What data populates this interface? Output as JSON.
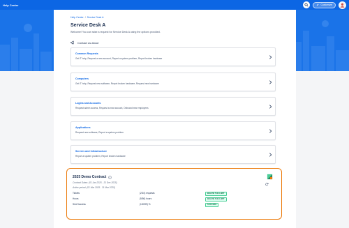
{
  "topbar": {
    "brand": "Help Center",
    "search_icon": "search-icon",
    "customize_label": "Customize",
    "customize_icon": "pencil-icon",
    "avatar_icon": "user-avatar-icon"
  },
  "breadcrumb": {
    "items": [
      "Help Center",
      "Service Desk A"
    ],
    "separator": "/"
  },
  "header": {
    "title": "Service Desk A",
    "subtitle": "Welcome! You can raise a request for Service Desk A using the options provided."
  },
  "contact": {
    "label": "Contact us about",
    "icon": "megaphone-icon"
  },
  "request_groups": [
    {
      "title": "Common Requests",
      "description": "Get IT help, Request a new account, Report a system problem, Report broken hardware"
    },
    {
      "title": "Computers",
      "description": "Get IT help, Request new software, Report broken hardware, Request new hardware"
    },
    {
      "title": "Logins and Accounts",
      "description": "Request admin access, Request a new account, Onboard new employees"
    },
    {
      "title": "Applications",
      "description": "Request new software, Report a system problem"
    },
    {
      "title": "Servers and Infrastructure",
      "description": "Report a system problem, Report broken hardware"
    }
  ],
  "contract": {
    "title": "2025 Demo Contract",
    "info_icon": "info-icon",
    "contract_dates": "Contract Dates: (01 Jan 2025 - 31 Dec 2025)",
    "active_period": "Active period: (01 Mar 2025 - 31 Mar 2025)",
    "metrics": [
      {
        "label": "Tickets",
        "value": "(2/10) requests",
        "status": "BELOW THE LIMIT"
      },
      {
        "label": "Hours",
        "value": "(5/50) hours",
        "status": "BELOW THE LIMIT"
      },
      {
        "label": "SLA Success",
        "value": "(100/99) %",
        "status": "SUCCESS"
      }
    ],
    "logo_icon": "app-logo-icon",
    "refresh_icon": "refresh-icon"
  },
  "colors": {
    "primary": "#0c66e4",
    "banner": "#1a73e8",
    "highlight_border": "#ec7b0c",
    "status_green": "#216e4e"
  }
}
